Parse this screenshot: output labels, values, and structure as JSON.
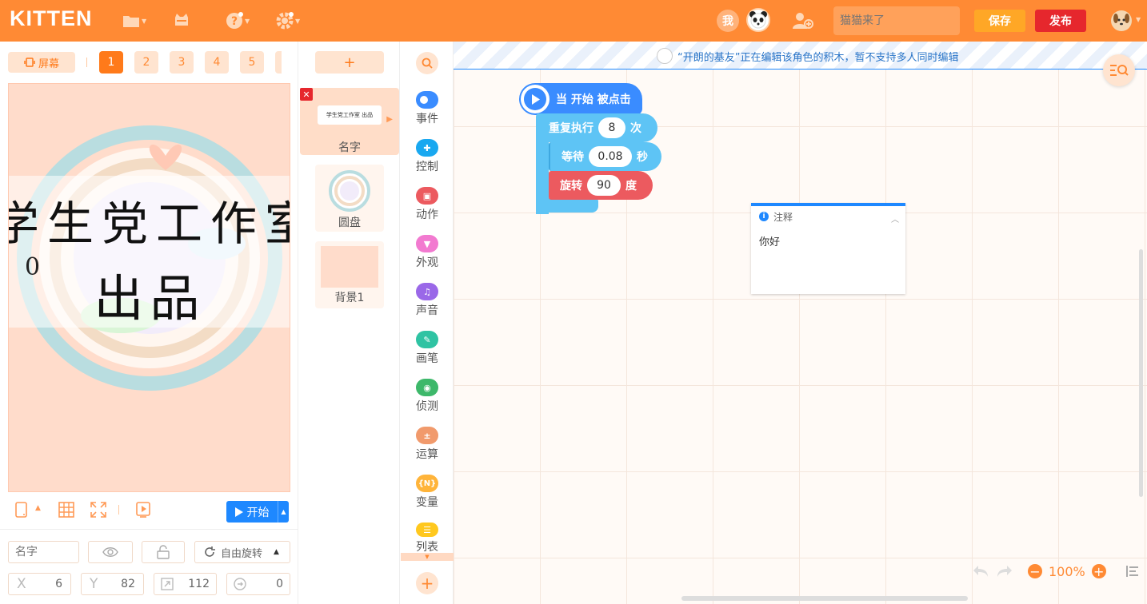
{
  "app": {
    "logo": "KITTEN"
  },
  "header": {
    "me_label": "我",
    "title_placeholder": "猫猫来了",
    "save_label": "保存",
    "publish_label": "发布"
  },
  "stage_panel": {
    "screen_label": "屏幕",
    "scenes": [
      "1",
      "2",
      "3",
      "4",
      "5"
    ],
    "active_scene": "1",
    "stage_text_line1": "学生党工作室",
    "stage_text_line2": "出品",
    "stage_variable_value": "0",
    "start_label": "开始",
    "name_placeholder": "名字",
    "rotation_label": "自由旋转",
    "x_label": "X",
    "x_value": "6",
    "y_label": "Y",
    "y_value": "82",
    "size_value": "112",
    "direction_value": "0"
  },
  "sprites": {
    "add_label": "+",
    "items": [
      {
        "name": "名字",
        "thumb_text": "学生党工作室 出品"
      },
      {
        "name": "圆盘"
      },
      {
        "name": "背景1"
      }
    ]
  },
  "categories": [
    {
      "label": "事件",
      "color": "#3a8cff",
      "icon": "toggle-icon"
    },
    {
      "label": "控制",
      "color": "#19a8f0",
      "icon": "gamepad-icon"
    },
    {
      "label": "动作",
      "color": "#ec5a5f",
      "icon": "robot-icon"
    },
    {
      "label": "外观",
      "color": "#f27ad0",
      "icon": "shirt-icon"
    },
    {
      "label": "声音",
      "color": "#9a68e8",
      "icon": "music-icon"
    },
    {
      "label": "画笔",
      "color": "#2fc3a3",
      "icon": "brush-icon"
    },
    {
      "label": "侦测",
      "color": "#3db86a",
      "icon": "target-icon"
    },
    {
      "label": "运算",
      "color": "#f19a6c",
      "icon": "math-icon"
    },
    {
      "label": "变量",
      "color": "#ffb43a",
      "icon": "variable-icon",
      "glyph": "{N}"
    },
    {
      "label": "列表",
      "color": "#ffc81e",
      "icon": "list-icon"
    }
  ],
  "workspace": {
    "notice": "“开朗的基友”正在编辑该角色的积木，暂不支持多人同时编辑",
    "blocks": {
      "hat_label": "当 开始 被点击",
      "repeat_label": "重复执行",
      "repeat_count": "8",
      "repeat_unit": "次",
      "wait_label": "等待",
      "wait_value": "0.08",
      "wait_unit": "秒",
      "rotate_label": "旋转",
      "rotate_value": "90",
      "rotate_unit": "度"
    },
    "comment": {
      "title": "注释",
      "text": "你好"
    },
    "zoom": "100%"
  }
}
